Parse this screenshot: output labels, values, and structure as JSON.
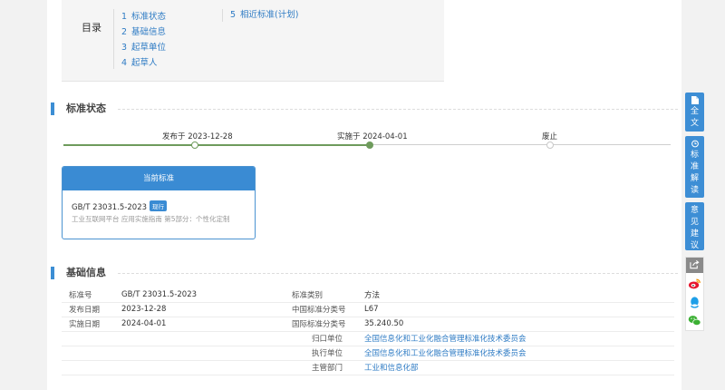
{
  "toc": {
    "title": "目录",
    "items": [
      {
        "num": "1",
        "label": "标准状态"
      },
      {
        "num": "2",
        "label": "基础信息"
      },
      {
        "num": "3",
        "label": "起草单位"
      },
      {
        "num": "4",
        "label": "起草人"
      },
      {
        "num": "5",
        "label": "相近标准(计划)"
      }
    ]
  },
  "status_section": {
    "title": "标准状态",
    "timeline": [
      {
        "label": "发布于 2023-12-28",
        "state": "done"
      },
      {
        "label": "实施于 2024-04-01",
        "state": "current"
      },
      {
        "label": "废止",
        "state": "pending"
      }
    ],
    "current_card": {
      "header": "当前标准",
      "code": "GB/T 23031.5-2023",
      "badge": "现行",
      "name": "工业互联网平台 应用实施指南 第5部分：个性化定制"
    }
  },
  "basic_section": {
    "title": "基础信息",
    "rows": [
      {
        "l1": "标准号",
        "v1": "GB/T 23031.5-2023",
        "l2": "标准类别",
        "v2": "方法"
      },
      {
        "l1": "发布日期",
        "v1": "2023-12-28",
        "l2": "中国标准分类号",
        "v2": "L67"
      },
      {
        "l1": "实施日期",
        "v1": "2024-04-01",
        "l2": "国际标准分类号",
        "v2": "35.240.50"
      },
      {
        "l1": "",
        "v1": "",
        "l2": "归口单位",
        "v2": "全国信息化和工业化融合管理标准化技术委员会"
      },
      {
        "l1": "",
        "v1": "",
        "l2": "执行单位",
        "v2": "全国信息化和工业化融合管理标准化技术委员会"
      },
      {
        "l1": "",
        "v1": "",
        "l2": "主管部门",
        "v2": "工业和信息化部"
      }
    ]
  },
  "side_panel": {
    "fulltext": [
      "全",
      "文"
    ],
    "interpret": [
      "标",
      "准",
      "解",
      "读"
    ],
    "feedback": [
      "意",
      "见",
      "建",
      "议"
    ],
    "share_icons": [
      "share-icon",
      "weibo-icon",
      "qq-icon",
      "wechat-icon"
    ]
  },
  "colors": {
    "accent": "#3a8bd3",
    "link": "#2e7bc4",
    "timeline_done": "#6e9b5c"
  }
}
